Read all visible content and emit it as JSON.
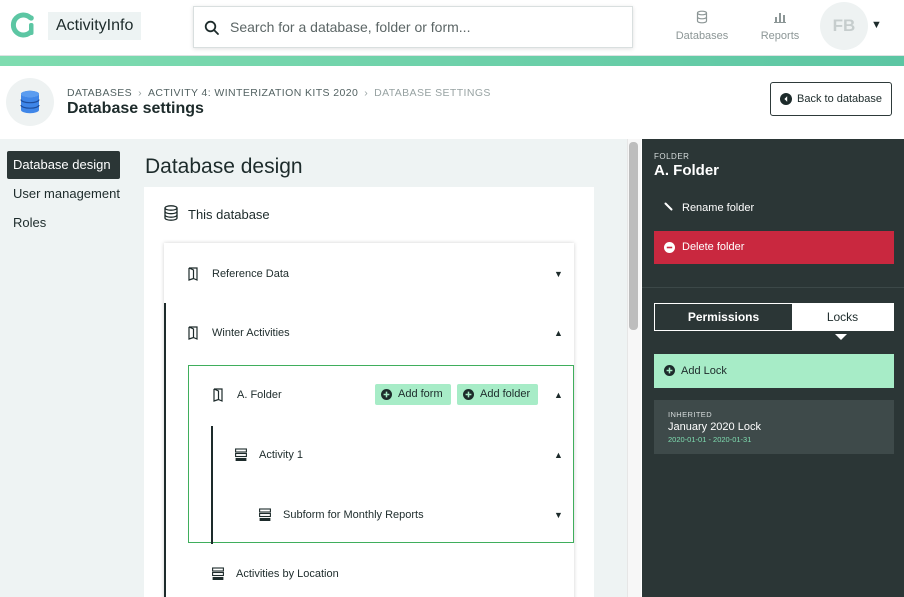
{
  "app": {
    "name": "ActivityInfo",
    "brand_color": "#5cc6a3"
  },
  "search": {
    "placeholder": "Search for a database, folder or form..."
  },
  "topnav": {
    "databases_label": "Databases",
    "reports_label": "Reports",
    "avatar_initials": "FB"
  },
  "header": {
    "breadcrumb": [
      "DATABASES",
      "ACTIVITY 4: WINTERIZATION KITS 2020",
      "DATABASE SETTINGS"
    ],
    "title": "Database settings",
    "back_label": "Back to database"
  },
  "sidebar": {
    "items": [
      {
        "label": "Database design",
        "active": true
      },
      {
        "label": "User management",
        "active": false
      },
      {
        "label": "Roles",
        "active": false
      }
    ]
  },
  "main": {
    "title": "Database design",
    "database_label": "This database",
    "tree": {
      "reference_data": "Reference Data",
      "winter_activities": "Winter Activities",
      "folder_a": "A. Folder",
      "add_form": "Add form",
      "add_folder": "Add folder",
      "activity_1": "Activity 1",
      "subform": "Subform for Monthly Reports",
      "activities_by_location": "Activities by Location"
    }
  },
  "panel": {
    "kicker": "FOLDER",
    "title": "A. Folder",
    "rename_label": "Rename folder",
    "delete_label": "Delete folder",
    "tabs": {
      "permissions": "Permissions",
      "locks": "Locks"
    },
    "add_lock_label": "Add Lock",
    "lock": {
      "kicker": "INHERITED",
      "name": "January 2020 Lock",
      "range": "2020-01-01 - 2020-01-31"
    }
  }
}
